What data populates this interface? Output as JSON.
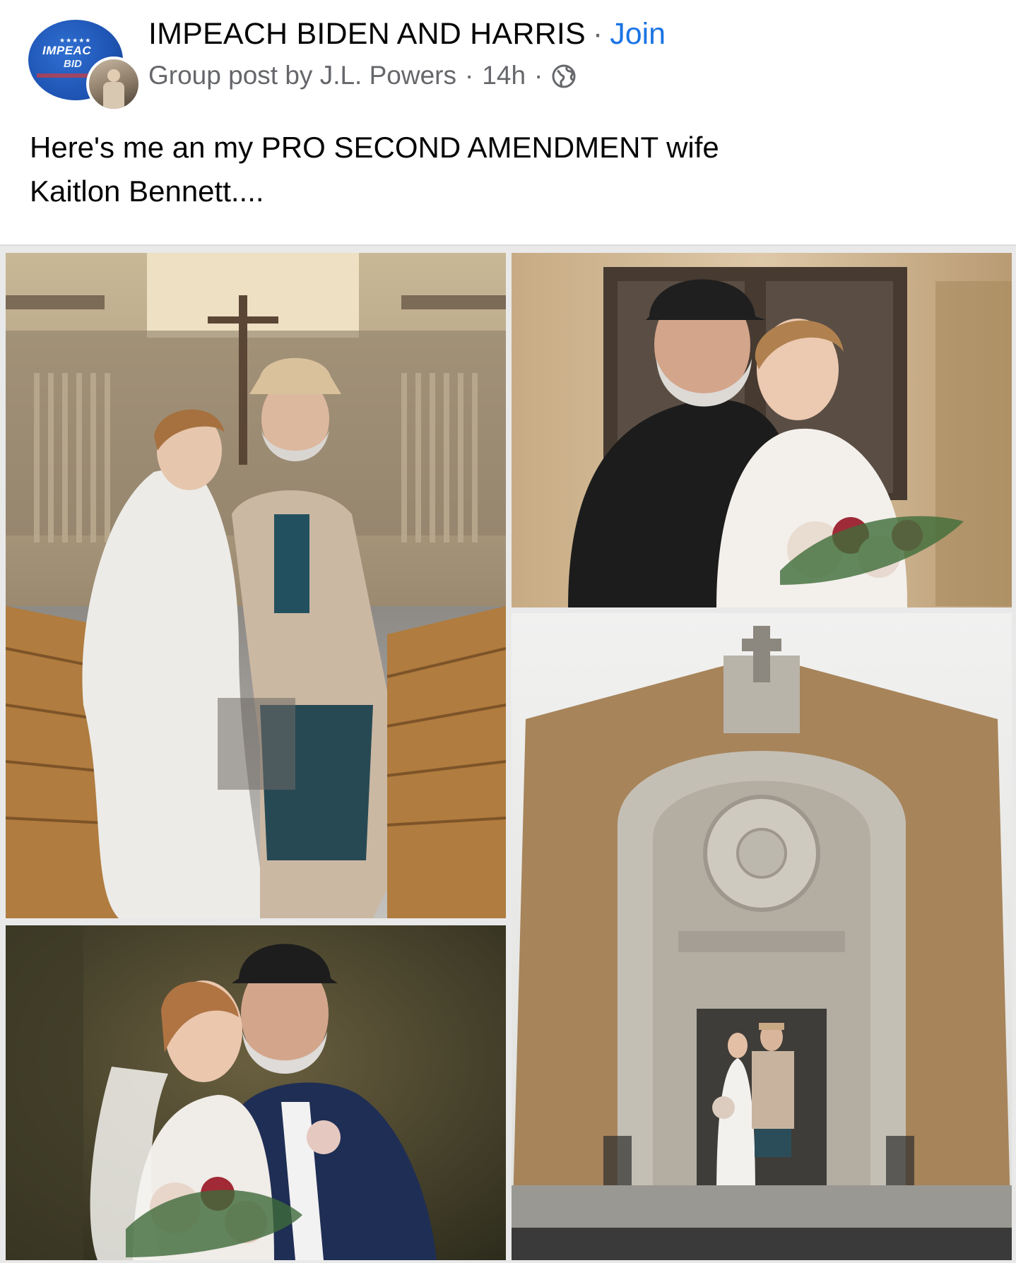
{
  "post": {
    "group_name": "IMPEACH BIDEN AND HARRIS",
    "title_separator": "·",
    "join_label": "Join",
    "meta_prefix": "Group post by",
    "author": "J.L. Powers",
    "meta_separator": "·",
    "time_ago": "14h",
    "privacy_icon": "globe-icon",
    "text": "Here's me an my PRO SECOND AMENDMENT wife\nKaitlon Bennett...."
  },
  "group_avatar": {
    "line1": "IMPEAC",
    "line2": "BID",
    "stars": "★★★★★"
  },
  "colors": {
    "link_blue": "#1b74e4",
    "text_primary": "#050505",
    "text_secondary": "#65676b"
  },
  "photos": [
    {
      "name": "photo-church-interior"
    },
    {
      "name": "photo-couple-outdoor"
    },
    {
      "name": "photo-couple-kiss"
    },
    {
      "name": "photo-church-exterior"
    }
  ]
}
